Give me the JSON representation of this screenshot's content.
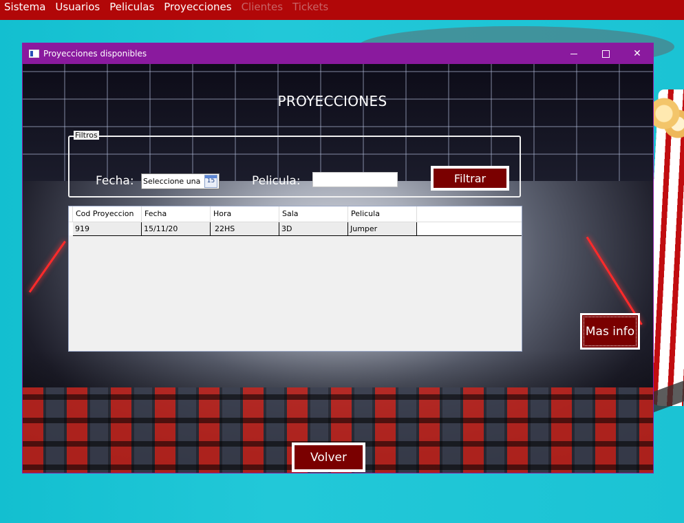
{
  "menubar": {
    "items": [
      {
        "label": "Sistema",
        "enabled": true
      },
      {
        "label": "Usuarios",
        "enabled": true
      },
      {
        "label": "Peliculas",
        "enabled": true
      },
      {
        "label": "Proyecciones",
        "enabled": true
      },
      {
        "label": "Clientes",
        "enabled": false
      },
      {
        "label": "Tickets",
        "enabled": false
      }
    ]
  },
  "window": {
    "title": "Proyecciones disponibles",
    "controls": {
      "minimize": "minimize-icon",
      "maximize": "maximize-icon",
      "close": "✕"
    }
  },
  "main": {
    "heading": "PROYECCIONES",
    "filter_group": {
      "legend": "Filtros",
      "fecha_label": "Fecha:",
      "fecha_value": "Seleccione una",
      "calendar_day": "15",
      "pelicula_label": "Pelicula:",
      "pelicula_value": "",
      "filter_button": "Filtrar"
    },
    "grid": {
      "columns": [
        "Cod Proyeccion",
        "Fecha",
        "Hora",
        "Sala",
        "Pelicula"
      ],
      "rows": [
        [
          "919",
          "15/11/20",
          "22HS",
          "3D",
          "Jumper"
        ]
      ]
    },
    "more_info_button": "Mas info",
    "back_button": "Volver"
  },
  "colors": {
    "menubar": "#b10708",
    "titlebar": "#8a1a9e",
    "button_bg": "#7a0000",
    "desktop": "#1bc3d4"
  }
}
